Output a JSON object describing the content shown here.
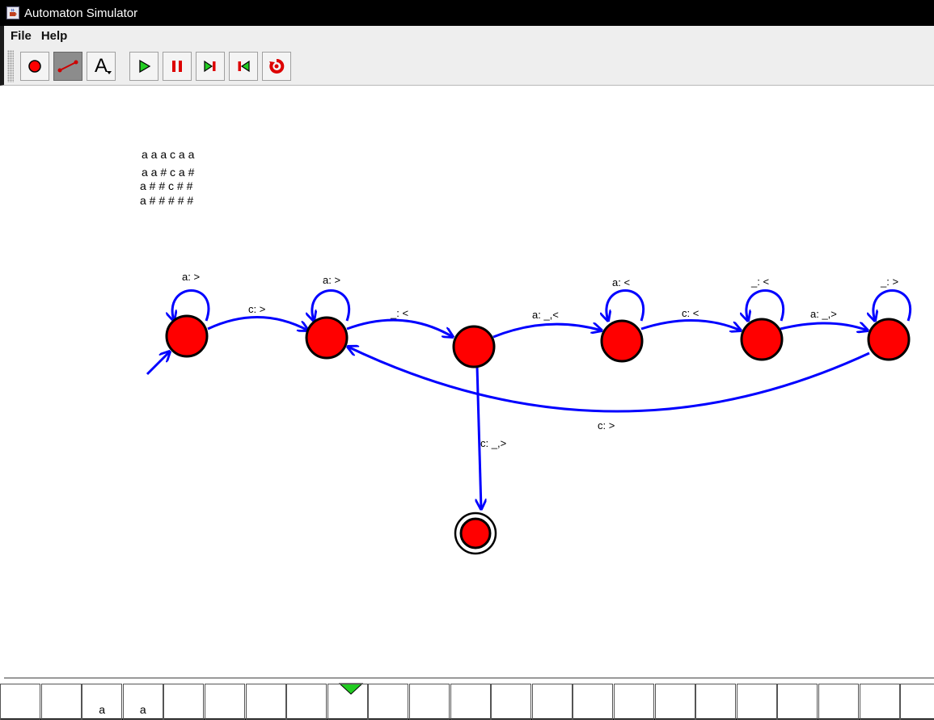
{
  "window": {
    "title": "Automaton Simulator"
  },
  "menu": {
    "file": "File",
    "help": "Help"
  },
  "toolbar": {
    "tools": [
      {
        "name": "add-state-tool",
        "icon": "red-dot-icon"
      },
      {
        "name": "add-transition-tool",
        "icon": "transition-arrow-icon",
        "selected": true
      },
      {
        "name": "edit-label-tool",
        "icon": "letter-a-icon",
        "label": "A"
      },
      {
        "name": "run-button",
        "icon": "play-icon"
      },
      {
        "name": "pause-button",
        "icon": "pause-icon"
      },
      {
        "name": "step-forward-button",
        "icon": "step-forward-icon"
      },
      {
        "name": "step-back-button",
        "icon": "step-back-icon"
      },
      {
        "name": "reset-button",
        "icon": "reset-icon"
      }
    ]
  },
  "canvas": {
    "trace_lines": [
      "a a a c a a",
      "a a # c a #",
      "a # # c # #",
      "a # # # # #"
    ],
    "transitions": {
      "loop_0": "a: >",
      "e0_1": "c: >",
      "loop_1": "a: >",
      "e1_2": "_: <",
      "e2_3": "a: _,<",
      "loop_3": "a: <",
      "e3_4": "c: <",
      "loop_4": "_: <",
      "e4_5": "a: _,>",
      "loop_5": "_: >",
      "e5_1": "c: >",
      "e2_accept": "c: _,>"
    },
    "colors": {
      "state_fill": "#ff0000",
      "edge": "#0000ff"
    }
  },
  "tape": {
    "cells": [
      "",
      "",
      "a",
      "a",
      "",
      "",
      "",
      "",
      "",
      "",
      "",
      "",
      "",
      "",
      "",
      "",
      "",
      "",
      "",
      "",
      "",
      "",
      ""
    ],
    "head_index": 8
  }
}
